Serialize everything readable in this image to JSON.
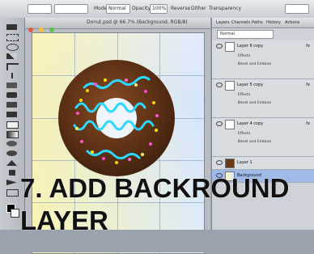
{
  "app": {
    "document_title": "Donut.psd @ 66.7% (Background, RGB/8)",
    "zoom": "66.7%"
  },
  "options_bar": {
    "mode_label": "Mode:",
    "mode_value": "Normal",
    "opacity_label": "Opacity:",
    "opacity_value": "100%",
    "reverse_label": "Reverse",
    "dither_label": "Dither",
    "transparency_label": "Transparency"
  },
  "layers_panel": {
    "tabs": [
      "Layers",
      "Channels",
      "Paths",
      "History",
      "Actions"
    ],
    "blend_mode": "Normal",
    "rows": [
      {
        "name": "Layer 6 copy",
        "fx": "fx",
        "subitems": [
          "Effects",
          "Bevel and Emboss"
        ]
      },
      {
        "name": "Layer 5 copy",
        "fx": "fx",
        "subitems": [
          "Effects",
          "Bevel and Emboss"
        ]
      },
      {
        "name": "Layer 4 copy",
        "fx": "fx",
        "subitems": [
          "Effects",
          "Bevel and Emboss"
        ]
      },
      {
        "name": "Layer 1",
        "fx": "",
        "subitems": []
      },
      {
        "name": "Background",
        "fx": "",
        "subitems": []
      }
    ]
  },
  "caption": {
    "line1": "7. ADD BACKROUND",
    "line2": "LAYER"
  },
  "colors": {
    "accent": "#9fb9e8",
    "donut": "#5a2f14",
    "icing": "#32d6ff"
  }
}
